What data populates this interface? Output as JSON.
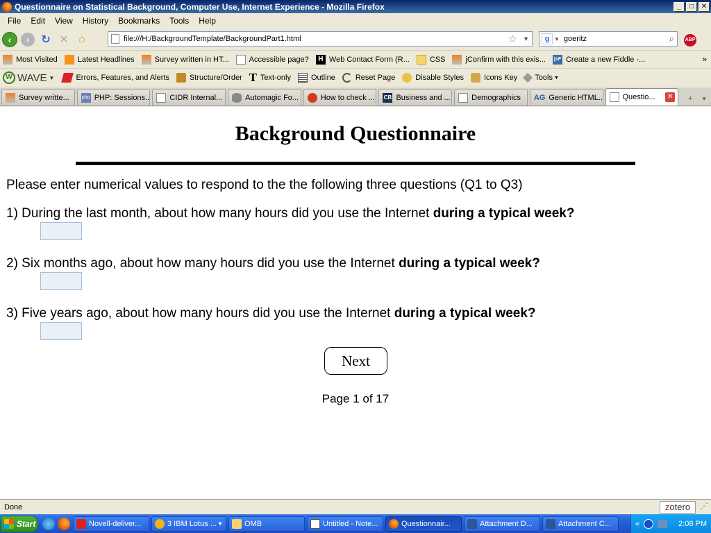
{
  "window": {
    "title": "Questionnaire on Statistical Background, Computer Use, Internet Experience - Mozilla Firefox",
    "min": "_",
    "max": "□",
    "close": "✕"
  },
  "menu": {
    "items": [
      "File",
      "Edit",
      "View",
      "History",
      "Bookmarks",
      "Tools",
      "Help"
    ]
  },
  "nav": {
    "url": "file:///H:/BackgroundTemplate/BackgroundPart1.html",
    "search_value": "goeritz",
    "abp": "ABP"
  },
  "bookmarks": {
    "items": [
      {
        "label": "Most Visited",
        "icon": "stackoverflow-icon"
      },
      {
        "label": "Latest Headlines",
        "icon": "rss-icon"
      },
      {
        "label": "Survey written in HT...",
        "icon": "stackoverflow-icon"
      },
      {
        "label": "Accessible page?",
        "icon": "page-icon"
      },
      {
        "label": "Web Contact Form (R...",
        "icon": "h-icon"
      },
      {
        "label": "CSS",
        "icon": "folder-icon"
      },
      {
        "label": "jConfirm with this exis...",
        "icon": "stackoverflow-icon"
      },
      {
        "label": "Create a new Fiddle -...",
        "icon": "jsfiddle-icon"
      }
    ],
    "more": "»"
  },
  "wave": {
    "logo": "WAVE",
    "items": [
      {
        "label": "Errors, Features, and Alerts"
      },
      {
        "label": "Structure/Order"
      },
      {
        "label": "Text-only"
      },
      {
        "label": "Outline"
      },
      {
        "label": "Reset Page"
      },
      {
        "label": "Disable Styles"
      },
      {
        "label": "Icons Key"
      },
      {
        "label": "Tools"
      }
    ]
  },
  "tabs": {
    "items": [
      {
        "label": "Survey writte..."
      },
      {
        "label": "PHP: Sessions..."
      },
      {
        "label": "CIDR Internal..."
      },
      {
        "label": "Automagic Fo..."
      },
      {
        "label": "How to check ..."
      },
      {
        "label": "Business and ..."
      },
      {
        "label": "Demographics"
      },
      {
        "label": "Generic HTML..."
      },
      {
        "label": "Questio..."
      }
    ],
    "php_icon": "php",
    "cb_icon": "CB",
    "ag_icon": "AG",
    "new_tab": "+",
    "dropdown": "▾"
  },
  "page": {
    "heading": "Background Questionnaire",
    "intro": "Please enter numerical values to respond to the the following three questions (Q1 to Q3)",
    "questions": [
      {
        "prefix": "1) During the last month, about how many hours did you use the Internet ",
        "bold": "during a typical week?",
        "value": ""
      },
      {
        "prefix": "2) Six months ago, about how many hours did you use the Internet ",
        "bold": "during a typical week?",
        "value": ""
      },
      {
        "prefix": "3) Five years ago, about how many hours did you use the Internet ",
        "bold": "during a typical week?",
        "value": ""
      }
    ],
    "next_label": "Next",
    "page_info": "Page 1 of 17"
  },
  "status": {
    "text": "Done",
    "zotero_z": "z",
    "zotero_rest": "otero"
  },
  "taskbar": {
    "start": "Start",
    "tasks": [
      {
        "label": "Novell-deliver..."
      },
      {
        "label": "3 IBM Lotus ..."
      },
      {
        "label": "OMB"
      },
      {
        "label": "Untitled - Note..."
      },
      {
        "label": "Questionnair..."
      },
      {
        "label": "Attachment D..."
      },
      {
        "label": "Attachment C..."
      }
    ],
    "tray_arrows": "«",
    "clock": "2:08 PM"
  },
  "colors": {
    "titlebar": "#0a246a",
    "input_fill": "#e8f0f8",
    "taskbar": "#245edc"
  }
}
